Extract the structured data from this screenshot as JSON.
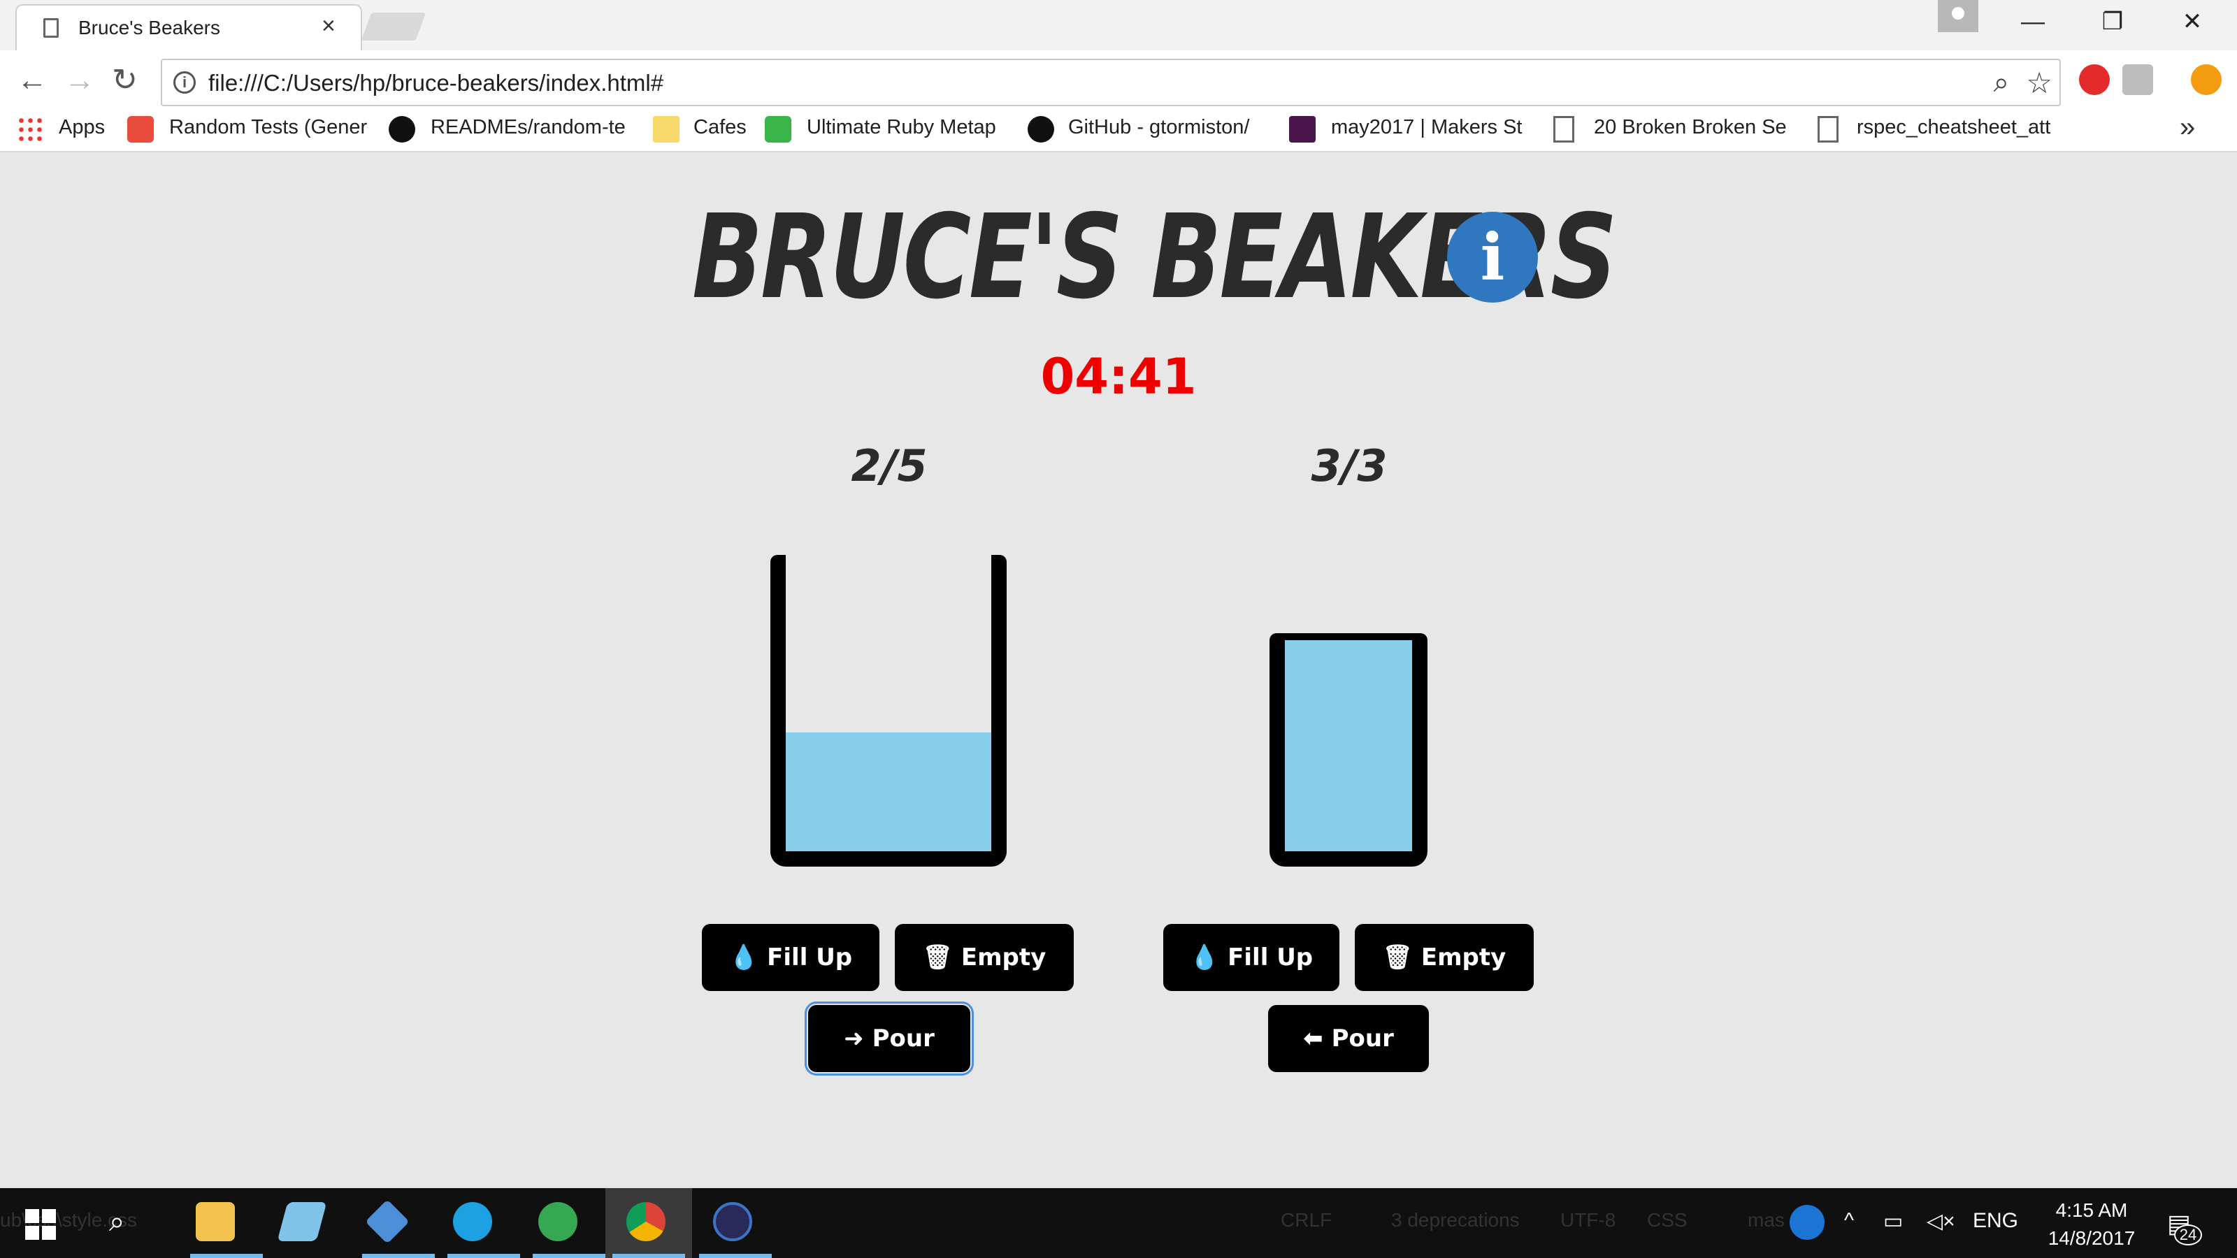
{
  "browser": {
    "tab_title": "Bruce's Beakers",
    "tab_close": "×",
    "url": "file:///C:/Users/hp/bruce-beakers/index.html#",
    "window_controls": {
      "minimize": "—",
      "restore": "❐",
      "close": "✕"
    },
    "nav": {
      "back": "←",
      "forward": "→",
      "reload": "↻"
    },
    "bookmarks": [
      {
        "label": "Apps",
        "icon": "apps-grid-icon"
      },
      {
        "label": "Random Tests (Gener",
        "icon": "random-icon"
      },
      {
        "label": "READMEs/random-te",
        "icon": "github-icon"
      },
      {
        "label": "Cafes",
        "icon": "folder-icon"
      },
      {
        "label": "Ultimate Ruby Metap",
        "icon": "udemy-icon"
      },
      {
        "label": "GitHub - gtormiston/",
        "icon": "github-icon"
      },
      {
        "label": "may2017 | Makers St",
        "icon": "slack-icon"
      },
      {
        "label": "20 Broken Broken Se",
        "icon": "page-icon"
      },
      {
        "label": "rspec_cheatsheet_att",
        "icon": "page-icon"
      }
    ],
    "bookmarks_more": "»"
  },
  "app": {
    "title": "BRUCE'S BEAKERS",
    "info_icon": "i",
    "timer": "04:41",
    "beakers": [
      {
        "capacity_label": "2/5",
        "amount": 2,
        "capacity": 5,
        "fill_up": "Fill Up",
        "empty": "Empty",
        "pour": "Pour",
        "pour_arrow": "➜"
      },
      {
        "capacity_label": "3/3",
        "amount": 3,
        "capacity": 3,
        "fill_up": "Fill Up",
        "empty": "Empty",
        "pour": "Pour",
        "pour_arrow": "⬅"
      }
    ],
    "icons": {
      "drop": "💧",
      "trash": "🗑"
    },
    "colors": {
      "liquid": "#87ceea",
      "timer": "#ee0000",
      "info": "#2f77bf",
      "button": "#000000"
    }
  },
  "taskbar": {
    "background_text": {
      "left": "ub\\css\\style.css",
      "crlf": "CRLF",
      "deprecations": "3 deprecations",
      "encoding": "UTF-8",
      "lang": "CSS",
      "branch": "mas"
    },
    "tray_lang": "ENG",
    "time": "4:15 AM",
    "date": "14/8/2017",
    "notification_count": "24"
  }
}
